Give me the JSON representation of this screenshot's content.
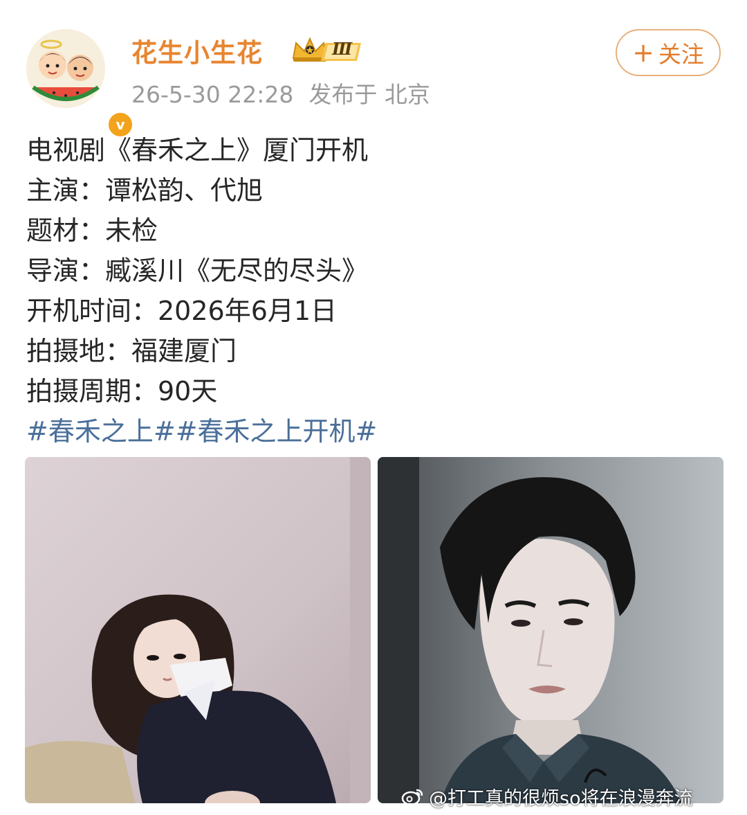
{
  "post": {
    "author": {
      "name": "花生小生花",
      "vip_level": "Ⅲ",
      "verified_mark": "v"
    },
    "timestamp": "26-5-30 22:28",
    "location": "发布于 北京",
    "follow_label": "关注",
    "lines": [
      "电视剧《春禾之上》厦门开机",
      "主演：谭松韵、代旭",
      "题材：未检",
      "导演：臧溪川《无尽的尽头》",
      "开机时间：2026年6月1日",
      "拍摄地：福建厦门",
      "拍摄周期：90天"
    ],
    "hashtags": [
      "#春禾之上#",
      "#春禾之上开机#"
    ]
  },
  "watermark": {
    "text": "@打工真的很烦so将在浪漫奔流"
  },
  "icons": {
    "avatar": "cartoon-couple-avatar",
    "verified": "verified-v-badge",
    "vip": "crown-vip-icon",
    "follow": "plus-icon",
    "watermark_logo": "weibo-logo-icon"
  },
  "colors": {
    "username": "#e8852f",
    "hashtag": "#4a6f9a",
    "meta": "#9a9a9a",
    "follow_border": "#e8b07a",
    "verified_badge": "#f3a21b"
  }
}
